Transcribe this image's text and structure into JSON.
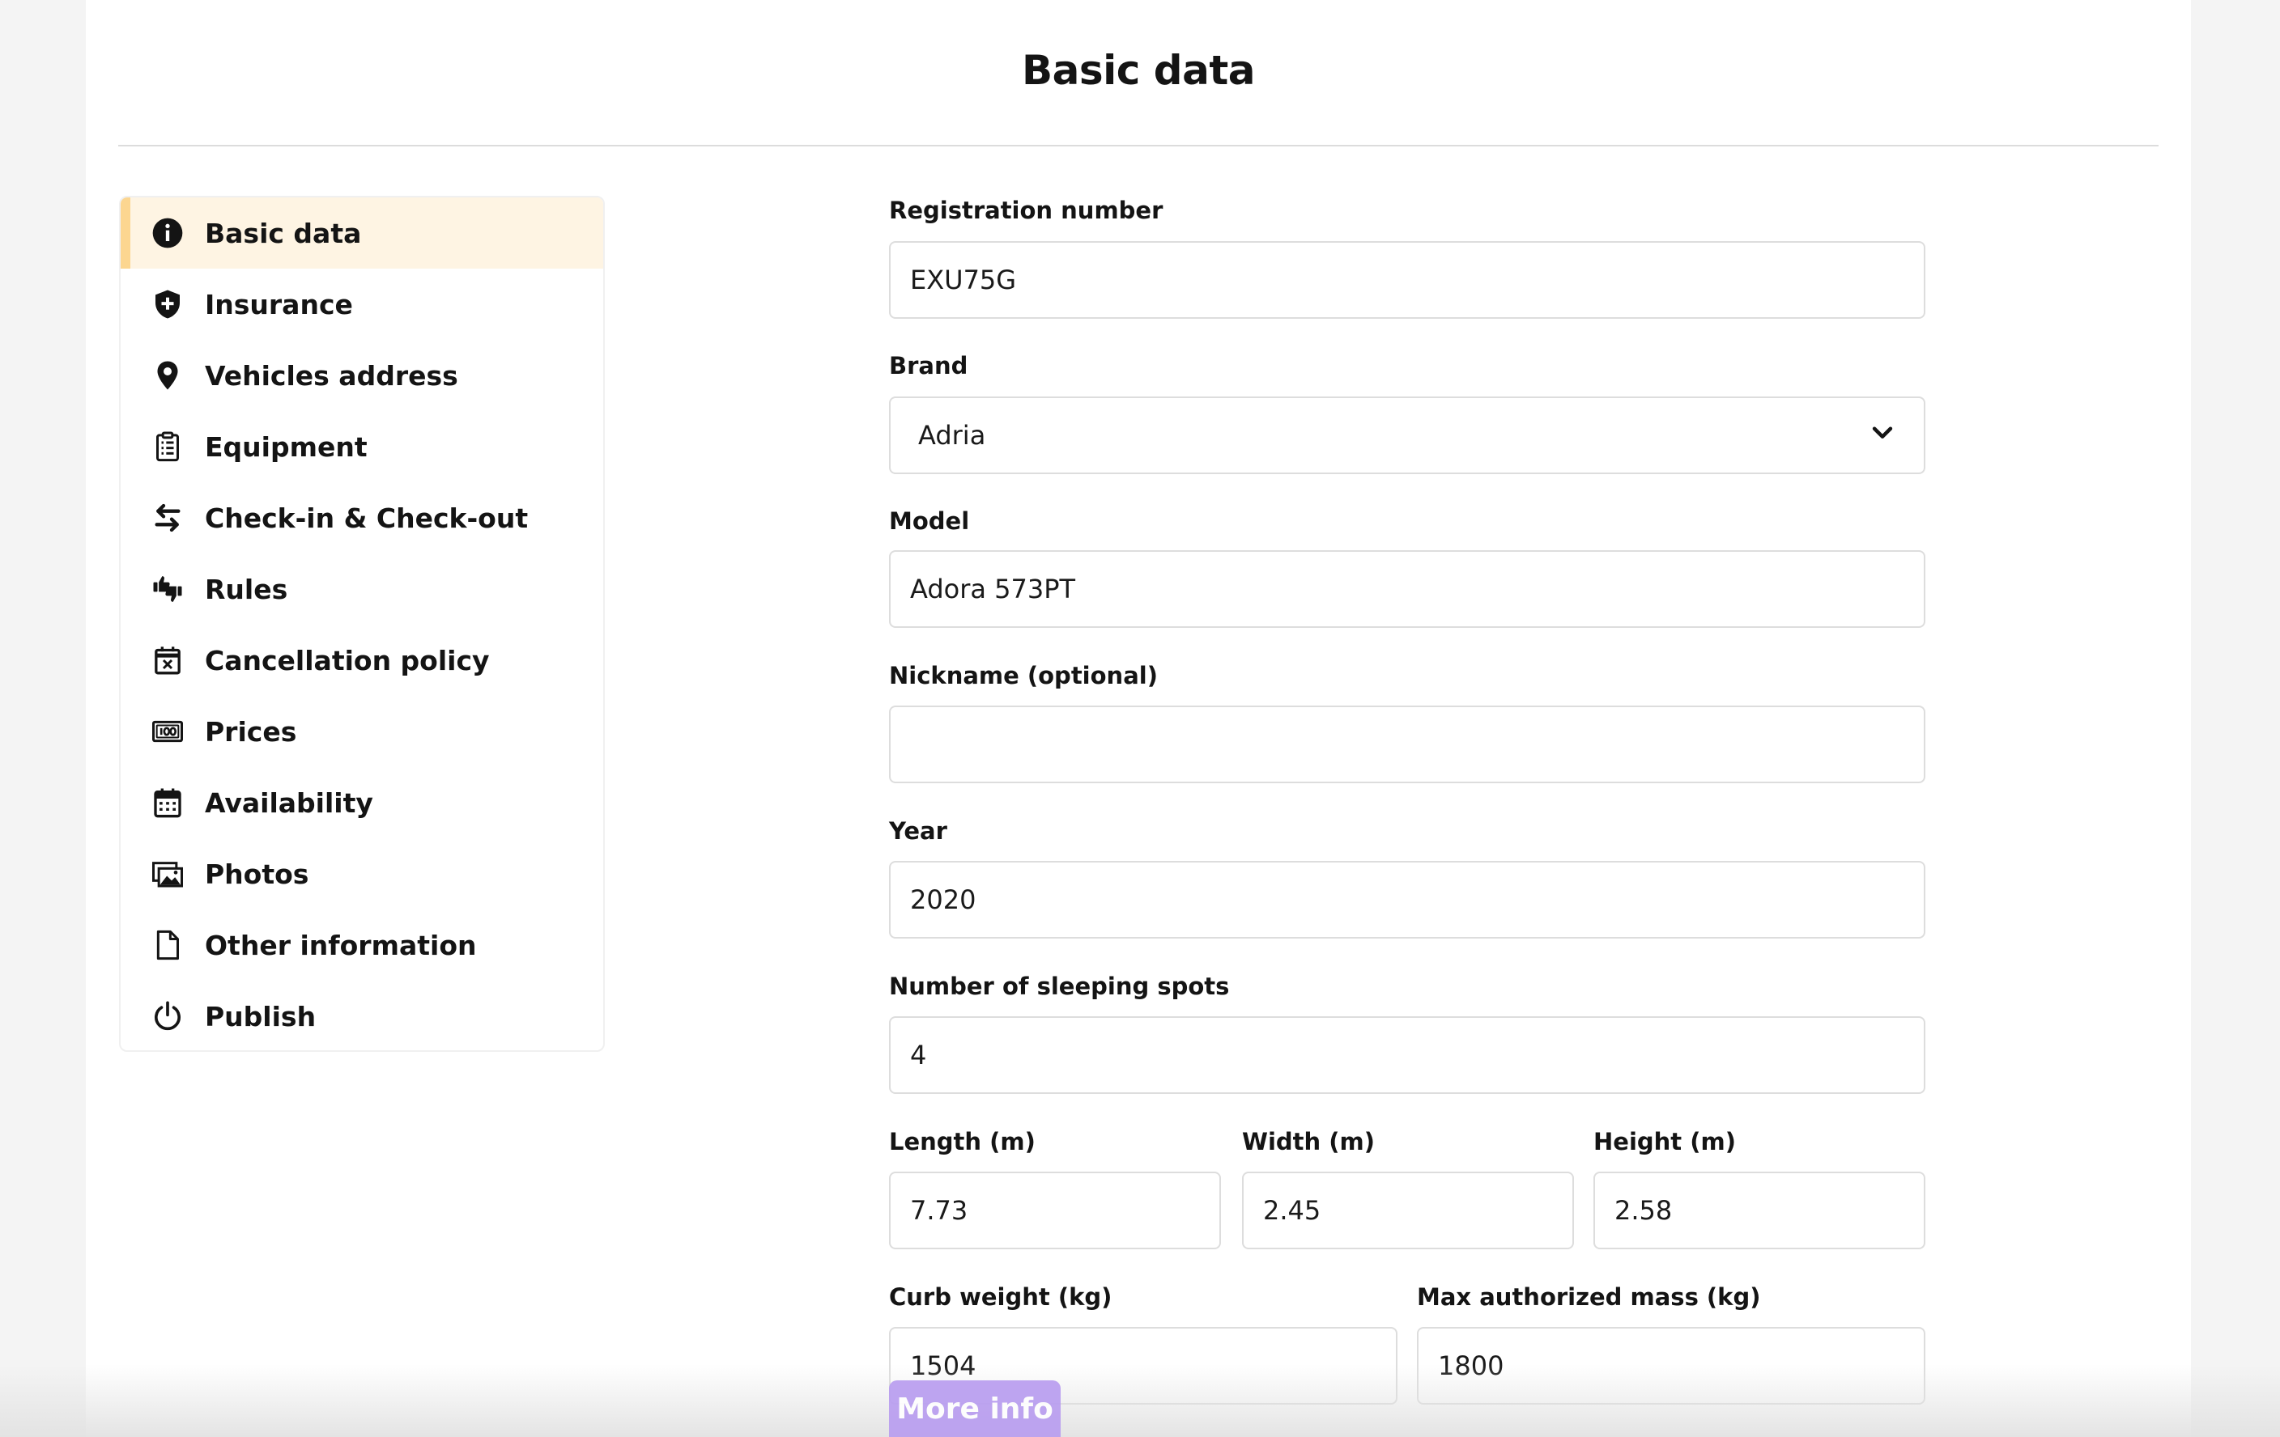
{
  "page": {
    "title": "Basic data"
  },
  "sidebar": {
    "items": [
      {
        "label": "Basic data",
        "icon": "info-icon"
      },
      {
        "label": "Insurance",
        "icon": "shield-plus-icon"
      },
      {
        "label": "Vehicles address",
        "icon": "map-pin-icon"
      },
      {
        "label": "Equipment",
        "icon": "clipboard-list-icon"
      },
      {
        "label": "Check-in & Check-out",
        "icon": "swap-arrows-icon"
      },
      {
        "label": "Rules",
        "icon": "thumbs-up-down-icon"
      },
      {
        "label": "Cancellation policy",
        "icon": "calendar-x-icon"
      },
      {
        "label": "Prices",
        "icon": "banknote-icon"
      },
      {
        "label": "Availability",
        "icon": "calendar-grid-icon"
      },
      {
        "label": "Photos",
        "icon": "images-icon"
      },
      {
        "label": "Other information",
        "icon": "document-icon"
      },
      {
        "label": "Publish",
        "icon": "power-icon"
      }
    ]
  },
  "form": {
    "registration": {
      "label": "Registration number",
      "value": "EXU75G"
    },
    "brand": {
      "label": "Brand",
      "value": "Adria"
    },
    "model": {
      "label": "Model",
      "value": "Adora 573PT"
    },
    "nickname": {
      "label": "Nickname (optional)",
      "value": ""
    },
    "year": {
      "label": "Year",
      "value": "2020"
    },
    "sleeping": {
      "label": "Number of sleeping spots",
      "value": "4"
    },
    "length": {
      "label": "Length (m)",
      "value": "7.73"
    },
    "width": {
      "label": "Width (m)",
      "value": "2.45"
    },
    "height": {
      "label": "Height (m)",
      "value": "2.58"
    },
    "curb_weight": {
      "label": "Curb weight (kg)",
      "value": "1504"
    },
    "max_mass": {
      "label": "Max authorized mass (kg)",
      "value": "1800"
    }
  },
  "more_info": {
    "label": "More info"
  },
  "colors": {
    "active_bg": "#fef4e3",
    "active_bar": "#fcd690",
    "more_info_bg": "#b89cf0"
  }
}
